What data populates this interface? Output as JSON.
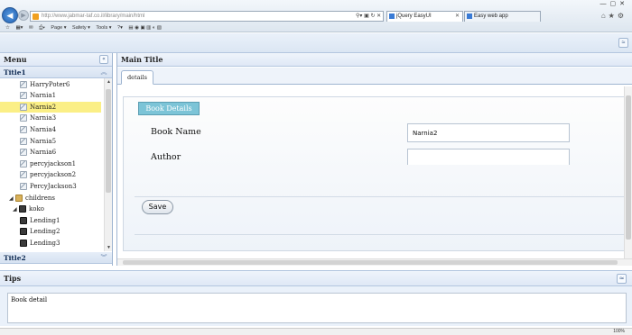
{
  "browser": {
    "url": "http://www.jabmar-taf.co.il/library/main/html",
    "tabs": [
      {
        "label": "jQuery EasyUI",
        "active": true
      },
      {
        "label": "Easy web app",
        "active": false
      }
    ],
    "command_bar": [
      "Page ▾",
      "Safety ▾",
      "Tools ▾"
    ],
    "zoom": "100%"
  },
  "menu": {
    "title": "Menu",
    "panels": [
      {
        "title": "Title1"
      },
      {
        "title": "Title2"
      }
    ],
    "tree": [
      {
        "label": "HarryPoter6",
        "level": 2,
        "icon": "leaf-icon",
        "selected": false
      },
      {
        "label": "Narnia1",
        "level": 2,
        "icon": "leaf-icon",
        "selected": false
      },
      {
        "label": "Narnia2",
        "level": 2,
        "icon": "leaf-icon",
        "selected": true
      },
      {
        "label": "Narnia3",
        "level": 2,
        "icon": "leaf-icon",
        "selected": false
      },
      {
        "label": "Narnia4",
        "level": 2,
        "icon": "leaf-icon",
        "selected": false
      },
      {
        "label": "Narnia5",
        "level": 2,
        "icon": "leaf-icon",
        "selected": false
      },
      {
        "label": "Narnia6",
        "level": 2,
        "icon": "leaf-icon",
        "selected": false
      },
      {
        "label": "percyjackson1",
        "level": 2,
        "icon": "leaf-icon",
        "selected": false
      },
      {
        "label": "percyjackson2",
        "level": 2,
        "icon": "leaf-icon",
        "selected": false
      },
      {
        "label": "PercyJackson3",
        "level": 2,
        "icon": "leaf-icon",
        "selected": false
      },
      {
        "label": "childrens",
        "level": 0,
        "icon": "folder-icon",
        "selected": false
      },
      {
        "label": "koko",
        "level": 1,
        "icon": "user-icon",
        "selected": false
      },
      {
        "label": "Lending1",
        "level": 2,
        "icon": "user-icon",
        "selected": false
      },
      {
        "label": "Lending2",
        "level": 2,
        "icon": "user-icon",
        "selected": false
      },
      {
        "label": "Lending3",
        "level": 2,
        "icon": "user-icon",
        "selected": false
      }
    ]
  },
  "main": {
    "title": "Main Title",
    "tab": "details",
    "form": {
      "legend": "Book Details",
      "fields": [
        {
          "label": "Book Name",
          "value": "Narnia2"
        },
        {
          "label": "Author",
          "value": ""
        }
      ],
      "save_label": "Save"
    }
  },
  "tips": {
    "title": "Tips",
    "text": "Book detail"
  }
}
